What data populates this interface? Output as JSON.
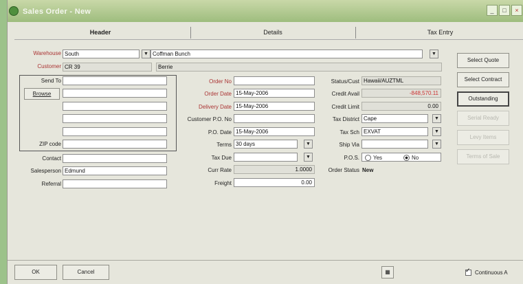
{
  "window": {
    "title": "Sales Order - New",
    "controls": [
      "_",
      "□",
      "×"
    ]
  },
  "tabs": [
    {
      "label": "Header"
    },
    {
      "label": "Details"
    },
    {
      "label": "Tax Entry"
    }
  ],
  "customer": {
    "warehouse_label": "Warehouse",
    "warehouse_value": "South",
    "customer_name_value": "Coffman Bunch",
    "customer_label": "Customer",
    "customer_code": "CR 39",
    "customer_extra": "Berrie",
    "send_to_label": "Send To",
    "browse_label": "Browse",
    "zip_label": "ZIP code",
    "contact_label": "Contact",
    "salesperson_label": "Salesperson",
    "salesperson_value": "Edmund",
    "referral_label": "Referral"
  },
  "order": {
    "order_no_label": "Order No",
    "order_date_label": "Order Date",
    "order_date_value": "15-May-2006",
    "delivery_date_label": "Delivery Date",
    "delivery_date_value": "15-May-2006",
    "customer_po_label": "Customer P.O. No",
    "po_date_label": "P.O. Date",
    "po_date_value": "15-May-2006",
    "terms_label": "Terms",
    "terms_value": "30 days",
    "tax_due_label": "Tax Due",
    "curr_rate_label": "Curr Rate",
    "curr_rate_value": "1.0000",
    "freight_label": "Freight",
    "freight_value": "0.00"
  },
  "status": {
    "status_label": "Status/Cust",
    "status_value": "Hawaii/AUZTML",
    "credit_avail_label": "Credit Avail",
    "credit_avail_value": "-848,570.11",
    "credit_limit_label": "Credit Limit",
    "credit_limit_value": "0.00",
    "tax_district_label": "Tax District",
    "tax_district_value": "Cape",
    "tax_sch_label": "Tax Sch",
    "tax_sch_value": "EXVAT",
    "ship_via_label": "Ship Via",
    "pos_label": "P.O.S.",
    "pos_yes": "Yes",
    "pos_no": "No",
    "order_status_label": "Order Status",
    "order_status_value": "New"
  },
  "side_buttons": {
    "select_quote": "Select Quote",
    "select_contract": "Select Contract",
    "outstanding": "Outstanding",
    "btn4": "Serial Ready",
    "btn5": "Levy Items",
    "btn6": "Terms of Sale"
  },
  "bottom": {
    "ok_label": "OK",
    "cancel_label": "Cancel",
    "continuous_label": "Continuous A"
  },
  "colors": {
    "title_green": "#9ebd7e",
    "form_bg": "#e6e6dc",
    "label_red": "#a33333",
    "credit_red": "#cc3333"
  }
}
